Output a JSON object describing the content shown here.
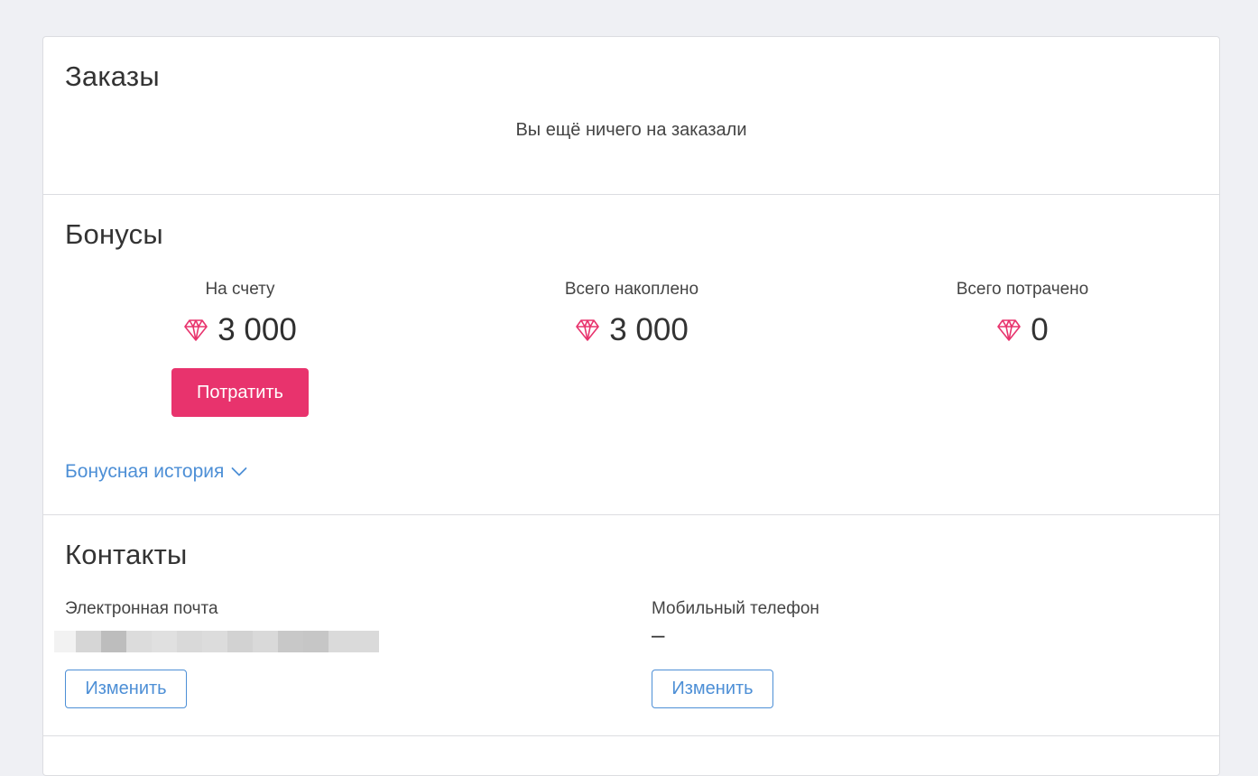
{
  "orders": {
    "title": "Заказы",
    "empty_text": "Вы ещё ничего на заказали"
  },
  "bonuses": {
    "title": "Бонусы",
    "stats": [
      {
        "label": "На счету",
        "value": "3 000"
      },
      {
        "label": "Всего накоплено",
        "value": "3 000"
      },
      {
        "label": "Всего потрачено",
        "value": "0"
      }
    ],
    "spend_button": "Потратить",
    "history_link": "Бонусная история",
    "gem_icon": "diamond-icon",
    "accent_color": "#e8336d"
  },
  "contacts": {
    "title": "Контакты",
    "email_label": "Электронная почта",
    "phone_label": "Мобильный телефон",
    "phone_value": "–",
    "edit_label": "Изменить",
    "link_color": "#4d8fd6"
  }
}
